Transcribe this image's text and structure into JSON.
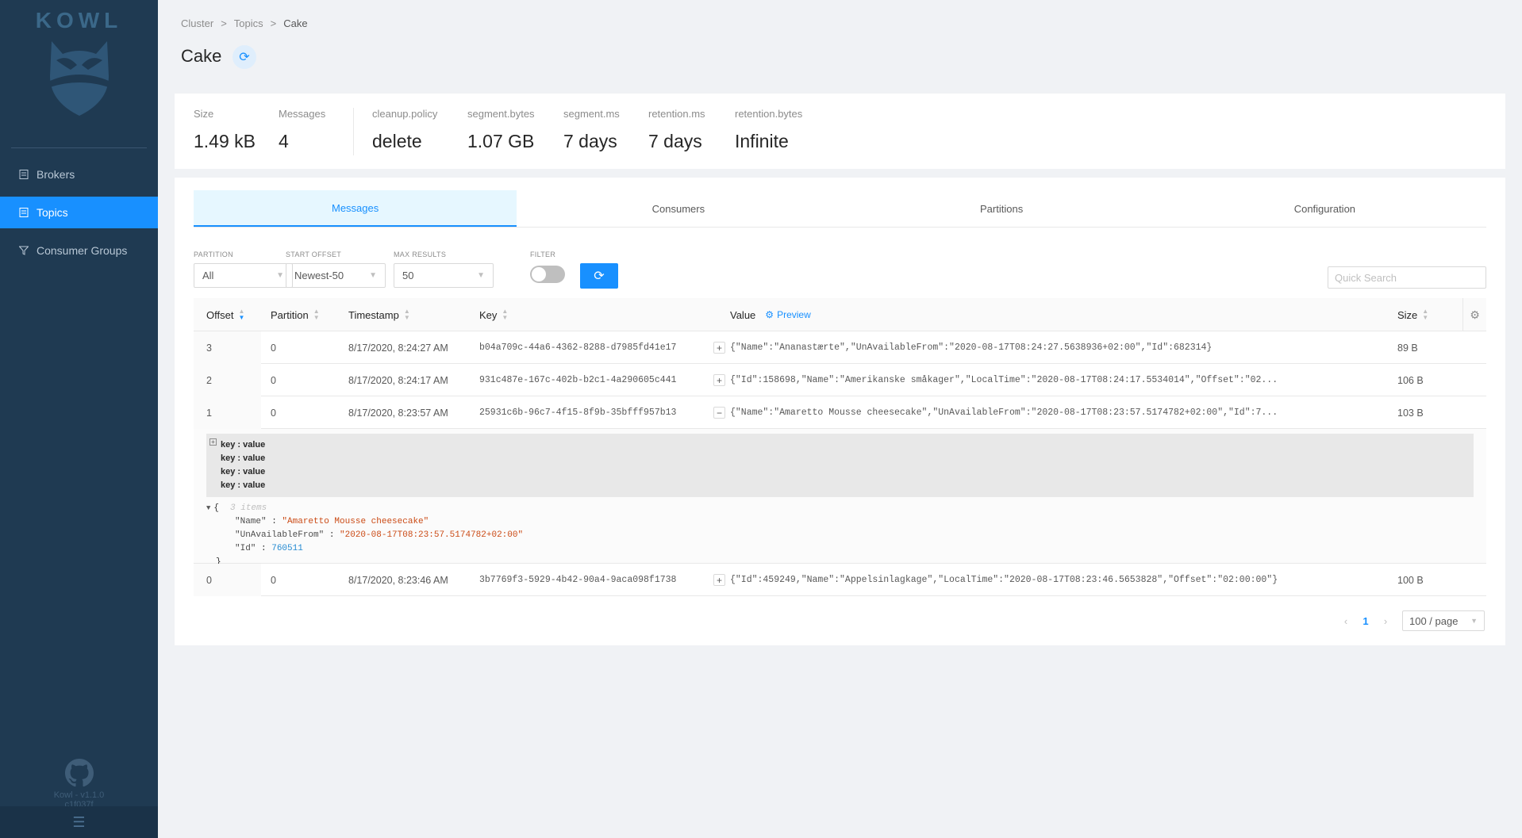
{
  "app": {
    "logo_text": "KOWL",
    "version": "Kowl - v1.1.0",
    "commit": "c1f037f"
  },
  "sidebar": {
    "items": [
      {
        "label": "Brokers",
        "icon": "brokers-icon",
        "active": false
      },
      {
        "label": "Topics",
        "icon": "topics-icon",
        "active": true
      },
      {
        "label": "Consumer Groups",
        "icon": "filter-icon",
        "active": false
      }
    ]
  },
  "breadcrumb": [
    "Cluster",
    "Topics",
    "Cake"
  ],
  "page_title": "Cake",
  "stats": [
    {
      "label": "Size",
      "value": "1.49 kB"
    },
    {
      "label": "Messages",
      "value": "4"
    },
    {
      "label": "cleanup.policy",
      "value": "delete"
    },
    {
      "label": "segment.bytes",
      "value": "1.07 GB"
    },
    {
      "label": "segment.ms",
      "value": "7 days"
    },
    {
      "label": "retention.ms",
      "value": "7 days"
    },
    {
      "label": "retention.bytes",
      "value": "Infinite"
    }
  ],
  "tabs": [
    "Messages",
    "Consumers",
    "Partitions",
    "Configuration"
  ],
  "active_tab": "Messages",
  "filters": {
    "partition": {
      "label": "PARTITION",
      "value": "All"
    },
    "start_offset": {
      "label": "START OFFSET",
      "value": "Newest-50"
    },
    "max_results": {
      "label": "MAX RESULTS",
      "value": "50"
    },
    "filter": {
      "label": "FILTER",
      "enabled": false
    }
  },
  "quick_search": {
    "placeholder": "Quick Search",
    "value": ""
  },
  "table": {
    "columns": {
      "offset": "Offset",
      "partition": "Partition",
      "timestamp": "Timestamp",
      "key": "Key",
      "value": "Value",
      "preview": "Preview",
      "size": "Size"
    },
    "rows": [
      {
        "offset": "3",
        "partition": "0",
        "timestamp": "8/17/2020, 8:24:27 AM",
        "key": "b04a709c-44a6-4362-8288-d7985fd41e17",
        "expand": "+",
        "value": "{\"Name\":\"Ananastærte\",\"UnAvailableFrom\":\"2020-08-17T08:24:27.5638936+02:00\",\"Id\":682314}",
        "size": "89 B"
      },
      {
        "offset": "2",
        "partition": "0",
        "timestamp": "8/17/2020, 8:24:17 AM",
        "key": "931c487e-167c-402b-b2c1-4a290605c441",
        "expand": "+",
        "value": "{\"Id\":158698,\"Name\":\"Amerikanske småkager\",\"LocalTime\":\"2020-08-17T08:24:17.5534014\",\"Offset\":\"02...",
        "size": "106 B"
      },
      {
        "offset": "1",
        "partition": "0",
        "timestamp": "8/17/2020, 8:23:57 AM",
        "key": "25931c6b-96c7-4f15-8f9b-35bfff957b13",
        "expand": "−",
        "value": "{\"Name\":\"Amaretto Mousse cheesecake\",\"UnAvailableFrom\":\"2020-08-17T08:23:57.5174782+02:00\",\"Id\":7...",
        "size": "103 B"
      }
    ],
    "last_row": {
      "offset": "0",
      "partition": "0",
      "timestamp": "8/17/2020, 8:23:46 AM",
      "key": "3b7769f3-5929-4b42-90a4-9aca098f1738",
      "expand": "+",
      "value": "{\"Id\":459249,\"Name\":\"Appelsinlagkage\",\"LocalTime\":\"2020-08-17T08:23:46.5653828\",\"Offset\":\"02:00:00\"}",
      "size": "100 B"
    }
  },
  "expanded": {
    "kv_lines": [
      "key : value",
      "key : value",
      "key : value",
      "key : value"
    ],
    "json_open": "{",
    "json_count": "3 items",
    "json_fields": [
      {
        "key": "\"Name\"",
        "value": "\"Amaretto Mousse cheesecake\"",
        "type": "string"
      },
      {
        "key": "\"UnAvailableFrom\"",
        "value": "\"2020-08-17T08:23:57.5174782+02:00\"",
        "type": "string"
      },
      {
        "key": "\"Id\"",
        "value": "760511",
        "type": "number"
      }
    ],
    "json_close": "}"
  },
  "pagination": {
    "current": "1",
    "page_size": "100 / page"
  },
  "colors": {
    "primary": "#1890ff",
    "sidebar": "#1f3a52"
  }
}
